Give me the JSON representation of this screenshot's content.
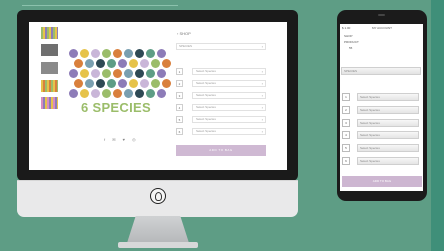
{
  "desktop": {
    "breadcrumb": "‹ SHOP",
    "first_select": "SPECIES",
    "product_title": "6 SPECIES",
    "share_icons": "f ✉ ♥ ◎",
    "rows": [
      {
        "num": "1",
        "placeholder": "Select Species"
      },
      {
        "num": "2",
        "placeholder": "Select Species"
      },
      {
        "num": "3",
        "placeholder": "Select Species"
      },
      {
        "num": "4",
        "placeholder": "Select Species"
      },
      {
        "num": "5",
        "placeholder": "Select Species"
      },
      {
        "num": "6",
        "placeholder": "Select Species"
      }
    ],
    "add_button": "ADD TO BAG",
    "dot_colors": [
      "#8d7cb8",
      "#9bbd6a",
      "#2f4a55",
      "#e6c34a",
      "#d9803d",
      "#5e9d85",
      "#c9b6d8",
      "#7a9fb0"
    ]
  },
  "phone": {
    "header_price": "$ 1.00",
    "header_link": "MY ACCOUNT",
    "nav": [
      "SHOP",
      "PRODUCT",
      "55"
    ],
    "first_select": "SPECIES",
    "rows": [
      {
        "num": "1",
        "placeholder": "Select Species"
      },
      {
        "num": "2",
        "placeholder": "Select Species"
      },
      {
        "num": "3",
        "placeholder": "Select Species"
      },
      {
        "num": "4",
        "placeholder": "Select Species"
      },
      {
        "num": "5",
        "placeholder": "Select Species"
      },
      {
        "num": "6",
        "placeholder": "Select Species"
      }
    ],
    "add_button": "ADD TO BAG"
  }
}
